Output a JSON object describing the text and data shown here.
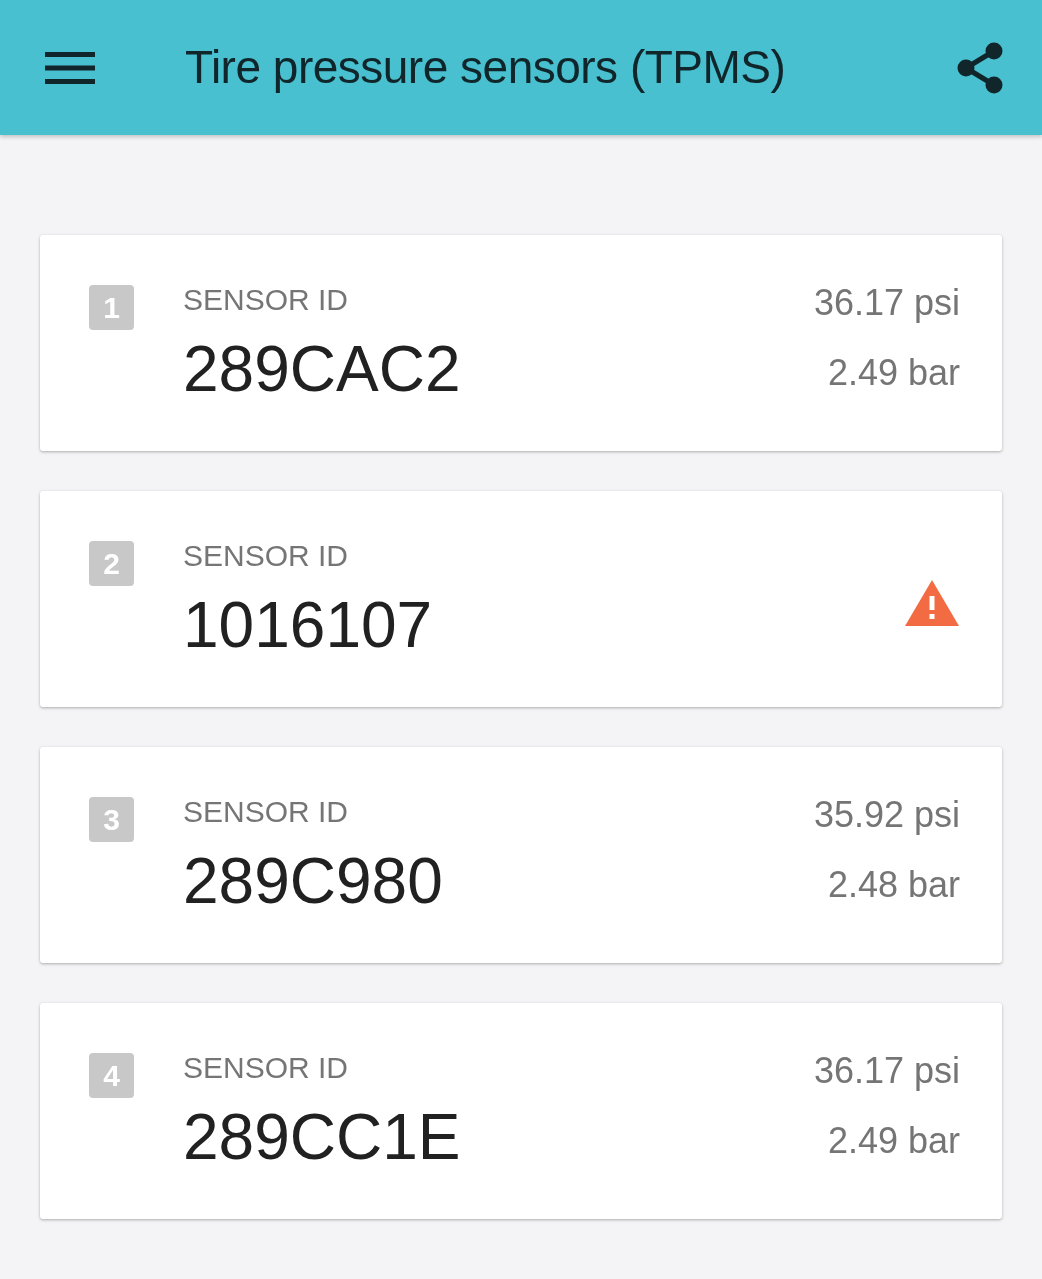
{
  "app_bar": {
    "title": "Tire pressure sensors (TPMS)"
  },
  "sensors": [
    {
      "number": "1",
      "label": "SENSOR ID",
      "id": "289CAC2",
      "kind": "reading",
      "psi": "36.17 psi",
      "bar": "2.49 bar"
    },
    {
      "number": "2",
      "label": "SENSOR ID",
      "id": "1016107",
      "kind": "warning"
    },
    {
      "number": "3",
      "label": "SENSOR ID",
      "id": "289C980",
      "kind": "reading",
      "psi": "35.92 psi",
      "bar": "2.48 bar"
    },
    {
      "number": "4",
      "label": "SENSOR ID",
      "id": "289CC1E",
      "kind": "reading",
      "psi": "36.17 psi",
      "bar": "2.49 bar"
    }
  ]
}
